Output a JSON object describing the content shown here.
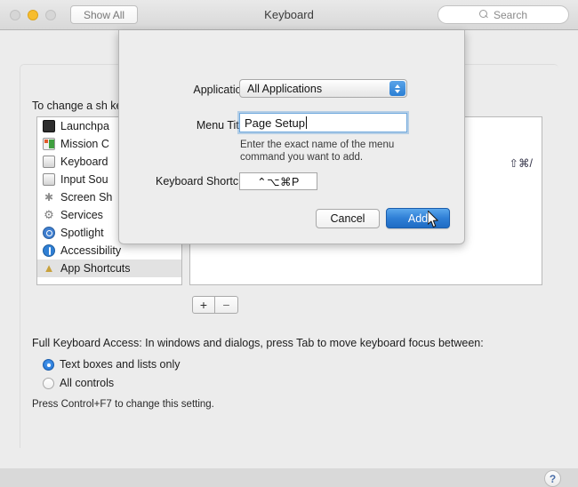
{
  "window": {
    "title": "Keyboard",
    "show_all_label": "Show All",
    "search_placeholder": "Search",
    "traffic_lights": [
      "close",
      "minimize",
      "maximize"
    ]
  },
  "main": {
    "intro_text": "To change a sh                                                                    keys.",
    "shortcut_list_right_value": "⇧⌘/",
    "add_button_label": "+",
    "remove_button_label": "−",
    "help_label": "?",
    "sidebar_items": [
      {
        "label": "Launchpa",
        "icon": "launchpad-icon",
        "selected": false
      },
      {
        "label": "Mission C",
        "icon": "mission-control-icon",
        "selected": false
      },
      {
        "label": "Keyboard",
        "icon": "keyboard-icon",
        "selected": false
      },
      {
        "label": "Input Sou",
        "icon": "input-sources-icon",
        "selected": false
      },
      {
        "label": "Screen Sh",
        "icon": "screenshot-icon",
        "selected": false
      },
      {
        "label": "Services",
        "icon": "services-gear-icon",
        "selected": false
      },
      {
        "label": "Spotlight",
        "icon": "spotlight-icon",
        "selected": false
      },
      {
        "label": "Accessibility",
        "icon": "accessibility-icon",
        "selected": false
      },
      {
        "label": "App Shortcuts",
        "icon": "app-shortcuts-icon",
        "selected": true
      }
    ],
    "full_keyboard_access": {
      "heading": "Full Keyboard Access: In windows and dialogs, press Tab to move keyboard focus between:",
      "options": [
        {
          "label": "Text boxes and lists only",
          "selected": true
        },
        {
          "label": "All controls",
          "selected": false
        }
      ],
      "hint": "Press Control+F7 to change this setting."
    }
  },
  "dialog": {
    "application_label": "Application:",
    "application_value": "All Applications",
    "menu_title_label": "Menu Title:",
    "menu_title_value": "Page Setup",
    "hint_text": "Enter the exact name of the menu command you want to add.",
    "keyboard_shortcut_label": "Keyboard Shortcut:",
    "keyboard_shortcut_value": "⌃⌥⌘P",
    "cancel_label": "Cancel",
    "add_label": "Add"
  },
  "colors": {
    "accent_blue": "#2f7fd6",
    "window_bg": "#ececec",
    "selection_grey": "#e2e2e2",
    "warning_yellow": "#f0b429"
  }
}
